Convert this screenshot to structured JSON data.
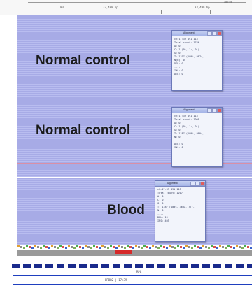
{
  "ruler": {
    "span_label": "385 bp",
    "ticks": [
      "80",
      "33,480 bp",
      "33,490 bp"
    ]
  },
  "tracks": [
    {
      "label": "Normal control",
      "popup": {
        "title": "Alignment",
        "lines": [
          "chr17:39 491 115",
          "Total count: 1786",
          "A: 0",
          "C: 1 (0%, 1+, 0-)",
          "G: 0",
          "T: 1197 (100%, 987+,",
          "N(N): 0",
          "DEL: 0",
          "----",
          "INS: 0",
          "DEL: 0"
        ]
      }
    },
    {
      "label": "Normal control",
      "popup": {
        "title": "Alignment",
        "lines": [
          "chr17:39 491 115",
          "Total count: 1009",
          "A: 0",
          "C: 1 (0%, 1+, 0-)",
          "G: 0",
          "T: 1187 (100%, 980+,",
          "N: 0",
          "----",
          "DEL: 0",
          "INS: 0"
        ]
      }
    },
    {
      "label": "Blood",
      "popup": {
        "title": "Alignment",
        "lines": [
          "chr17:39 491 115",
          "Total count: 1207",
          "A: 0",
          "C: 0",
          "G: 0",
          "T: 1187 (100%, 360+, 777-",
          "N: 0",
          "----",
          "DEL: 19",
          "INS: 405"
        ]
      }
    }
  ],
  "footer": {
    "coord_label": "RPL",
    "bottom_caption": "ERBB2 | 17:39"
  },
  "colors": {
    "track_fill": "#a9aee8",
    "popup_border": "#6b78b8",
    "divider_pink": "#d98fa6",
    "cursor_purple": "#6a4fcf",
    "gene_blue": "#1a2a8c"
  }
}
